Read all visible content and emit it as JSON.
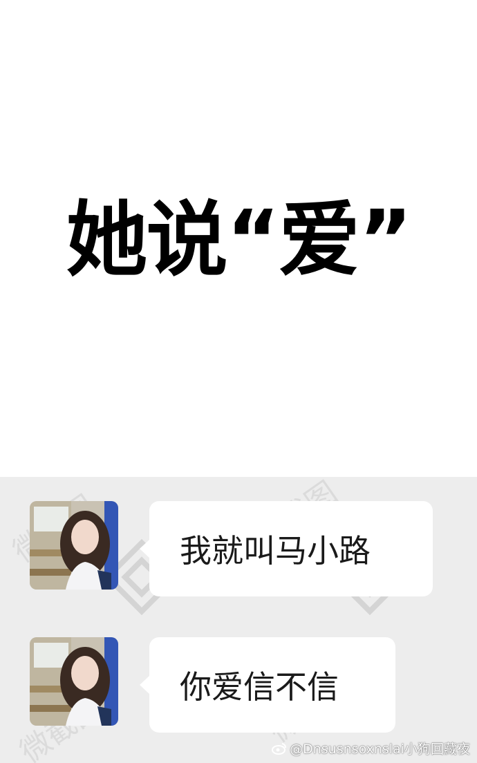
{
  "headline": "她说“爱”",
  "messages": [
    {
      "sender": "avatar-girl",
      "text": "我就叫马小路"
    },
    {
      "sender": "avatar-girl",
      "text": "你爱信不信"
    }
  ],
  "watermark": {
    "credit": "@Dnsusnsoxnslai小狗回藏夜"
  },
  "colors": {
    "chat_background": "#ededed",
    "bubble": "#ffffff",
    "headline": "#000000"
  }
}
